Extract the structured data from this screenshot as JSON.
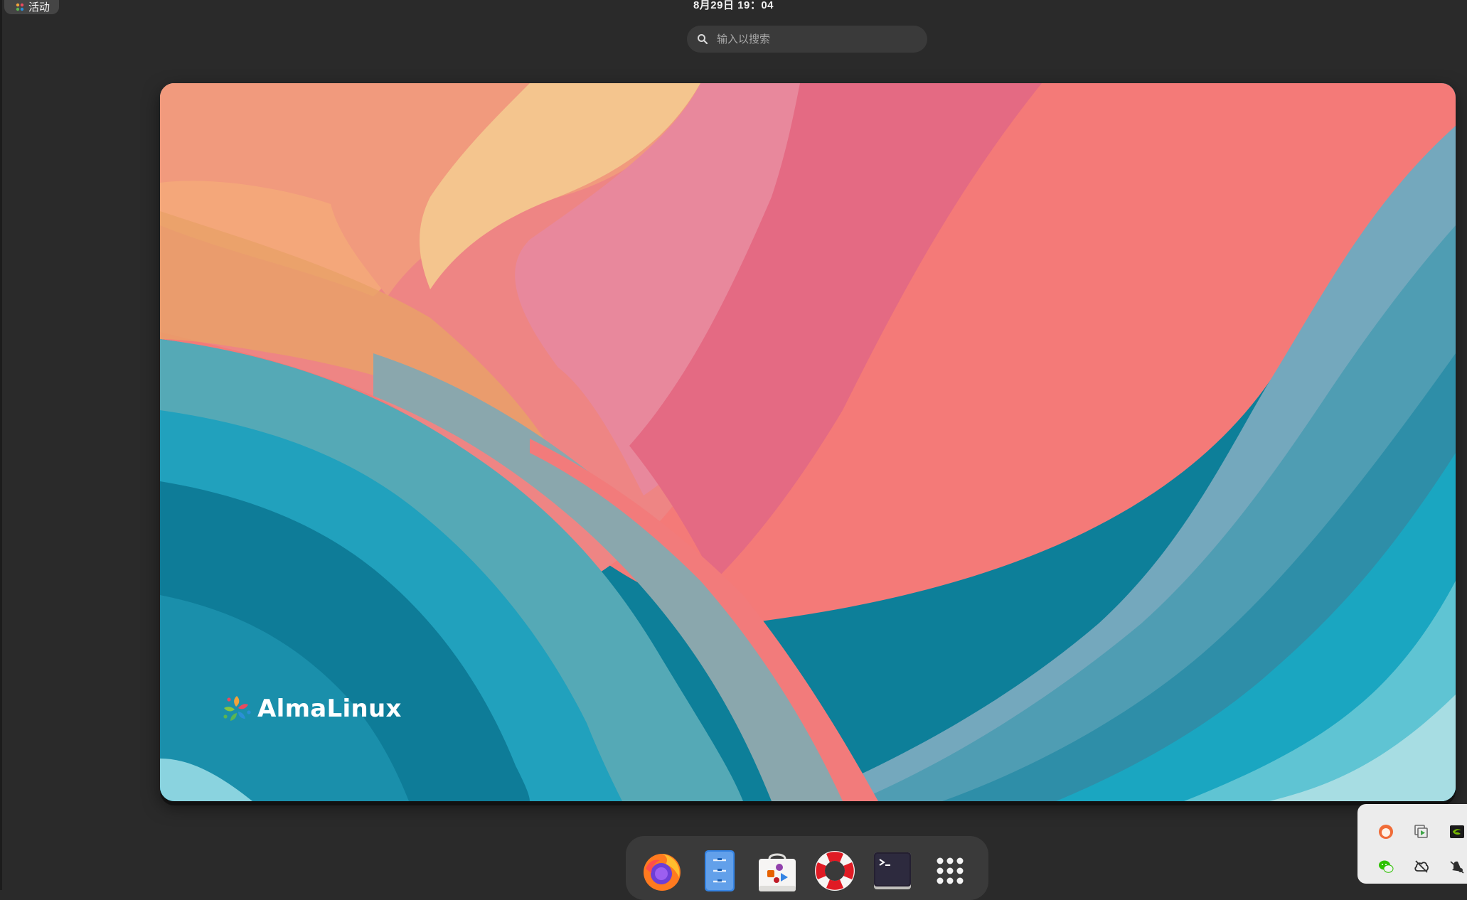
{
  "top_bar": {
    "activities_label": "活动",
    "clock": "8月29日 19：04"
  },
  "search": {
    "placeholder": "输入以搜索",
    "value": ""
  },
  "workspace": {
    "wallpaper_brand": "AlmaLinux"
  },
  "dash": {
    "items": [
      {
        "name": "Firefox",
        "icon": "firefox-icon"
      },
      {
        "name": "Files",
        "icon": "files-icon"
      },
      {
        "name": "Software",
        "icon": "software-center-icon"
      },
      {
        "name": "Help",
        "icon": "help-lifebuoy-icon"
      },
      {
        "name": "Terminal",
        "icon": "terminal-icon"
      },
      {
        "name": "Show Applications",
        "icon": "app-grid-icon"
      }
    ]
  },
  "tray": {
    "icons": [
      "cat-icon",
      "copy-play-icon",
      "nvidia-icon",
      "wechat-icon",
      "cloud-off-icon",
      "notification-mute-icon"
    ]
  },
  "colors": {
    "panel_bg": "#2a2a2a",
    "dash_bg": "#3a3a3a",
    "search_bg": "#3a3a3a",
    "wallpaper_teal": "#0d7f99",
    "wallpaper_coral": "#f47a78",
    "wallpaper_peach": "#f3a676"
  }
}
